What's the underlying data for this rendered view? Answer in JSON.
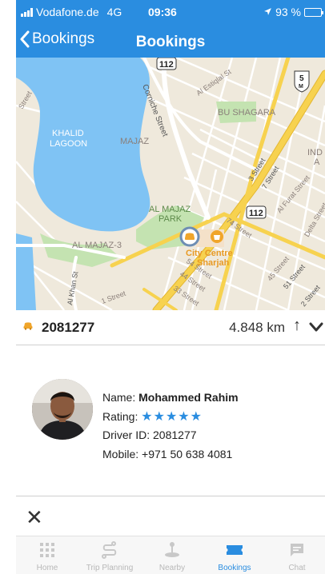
{
  "status_bar": {
    "carrier": "Vodafone.de",
    "network": "4G",
    "time": "09:36",
    "battery": "93 %",
    "battery_level": 0.93
  },
  "nav": {
    "back_label": "Bookings",
    "title": "Bookings"
  },
  "map": {
    "labels": {
      "khalid_lagoon": [
        "KHALID",
        "LAGOON"
      ],
      "majaz": "MAJAZ",
      "bu_shagara": "BU SHAGARA",
      "al_majaz_park": [
        "AL MAJAZ",
        "PARK"
      ],
      "al_majaz_3": "AL MAJAZ-3",
      "city_centre": [
        "City Centre",
        "Sharjah"
      ],
      "corniche_street": "Corniche Street",
      "al_estiqlal": "Al Estiqlal St",
      "street_3": "3 Street",
      "street_7": "7 Street",
      "al_furat": "Al Furat Street",
      "street_74": "74 Street",
      "street_54": "54 Street",
      "street_44": "44 Street",
      "street_45": "45 Street",
      "street_51": "51 Street",
      "street_2": "2 Street",
      "street_1": "1 Street",
      "street_33": "33 Street",
      "al_khan": "Al Khan St",
      "delta": "Delta Street",
      "ind": [
        "IND",
        "A"
      ],
      "street_left": "Street"
    },
    "shields": {
      "route_112_top": "112",
      "route_112_mid": "112",
      "route_5": "5",
      "route_5_sub": "M"
    }
  },
  "booking": {
    "id": "2081277",
    "distance": "4.848 km",
    "arrow": "↑"
  },
  "driver": {
    "name_label": "Name:",
    "name": "Mohammed Rahim",
    "rating_label": "Rating:",
    "rating_stars": "★★★★★",
    "rating_value": 5,
    "driver_id_label": "Driver ID:",
    "driver_id": "2081277",
    "mobile_label": "Mobile:",
    "mobile": "+971 50 638 4081"
  },
  "close_label": "✕",
  "tabs": [
    {
      "label": "Home",
      "icon": "grid-icon",
      "active": false
    },
    {
      "label": "Trip Planning",
      "icon": "route-icon",
      "active": false
    },
    {
      "label": "Nearby",
      "icon": "joystick-icon",
      "active": false
    },
    {
      "label": "Bookings",
      "icon": "ticket-icon",
      "active": true
    },
    {
      "label": "Chat",
      "icon": "chat-icon",
      "active": false
    }
  ],
  "colors": {
    "accent": "#2a8de0",
    "water": "#7fc3f4",
    "road_major": "#f7d24f",
    "park": "#c4e3b1",
    "car_marker": "#f0a52a",
    "battery_fill": "#ffd60a"
  }
}
